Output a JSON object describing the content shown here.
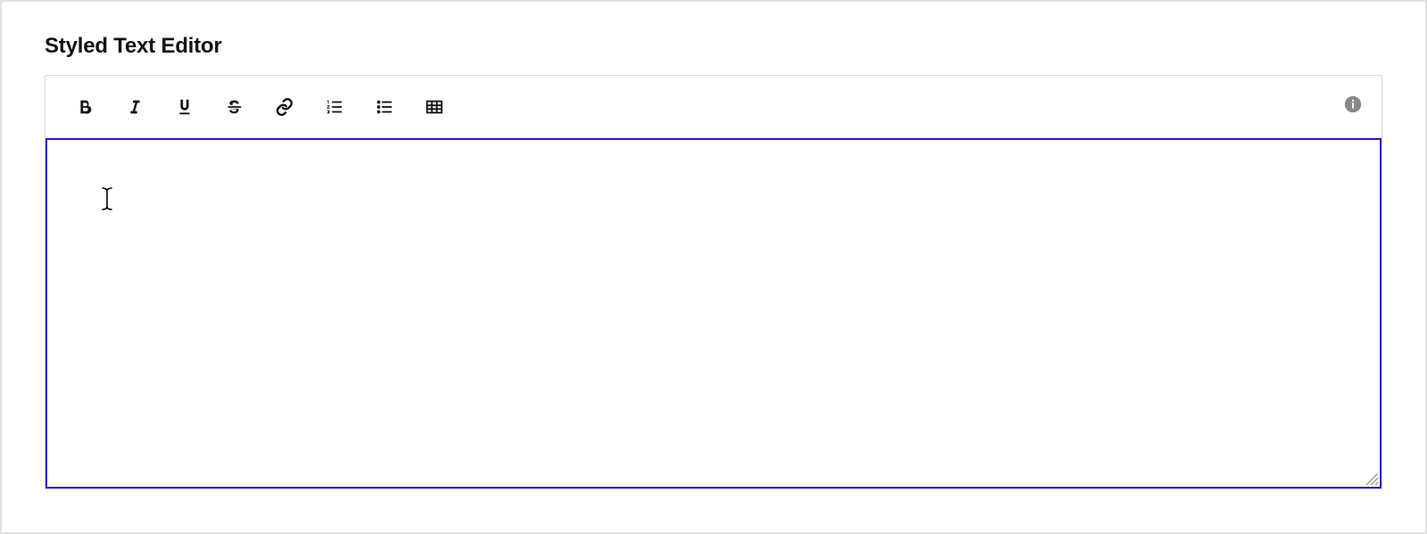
{
  "header": {
    "title": "Styled Text Editor"
  },
  "toolbar": {
    "buttons": [
      {
        "name": "bold",
        "label": "Bold"
      },
      {
        "name": "italic",
        "label": "Italic"
      },
      {
        "name": "underline",
        "label": "Underline"
      },
      {
        "name": "strikethrough",
        "label": "Strikethrough"
      },
      {
        "name": "link",
        "label": "Link"
      },
      {
        "name": "ordered-list",
        "label": "Numbered list"
      },
      {
        "name": "unordered-list",
        "label": "Bulleted list"
      },
      {
        "name": "table",
        "label": "Insert table"
      }
    ],
    "info_label": "Info"
  },
  "editor": {
    "value": "",
    "placeholder": ""
  }
}
